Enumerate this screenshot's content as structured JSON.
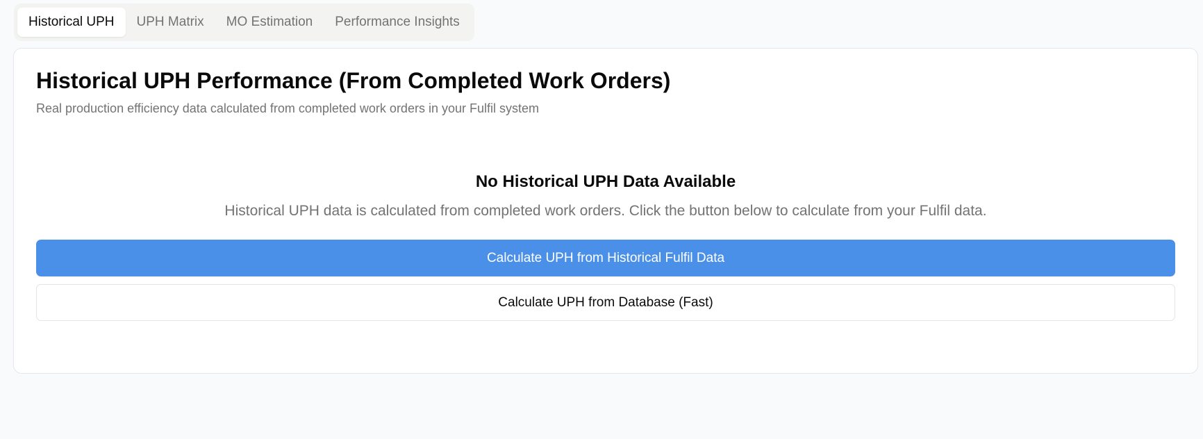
{
  "tabs": [
    {
      "label": "Historical UPH",
      "active": true
    },
    {
      "label": "UPH Matrix",
      "active": false
    },
    {
      "label": "MO Estimation",
      "active": false
    },
    {
      "label": "Performance Insights",
      "active": false
    }
  ],
  "card": {
    "title": "Historical UPH Performance (From Completed Work Orders)",
    "subtitle": "Real production efficiency data calculated from completed work orders in your Fulfil system"
  },
  "empty_state": {
    "title": "No Historical UPH Data Available",
    "description": "Historical UPH data is calculated from completed work orders. Click the button below to calculate from your Fulfil data."
  },
  "actions": {
    "primary_label": "Calculate UPH from Historical Fulfil Data",
    "secondary_label": "Calculate UPH from Database (Fast)"
  },
  "colors": {
    "primary": "#4a90e8",
    "background": "#f9fafb",
    "muted_text": "#737373"
  }
}
